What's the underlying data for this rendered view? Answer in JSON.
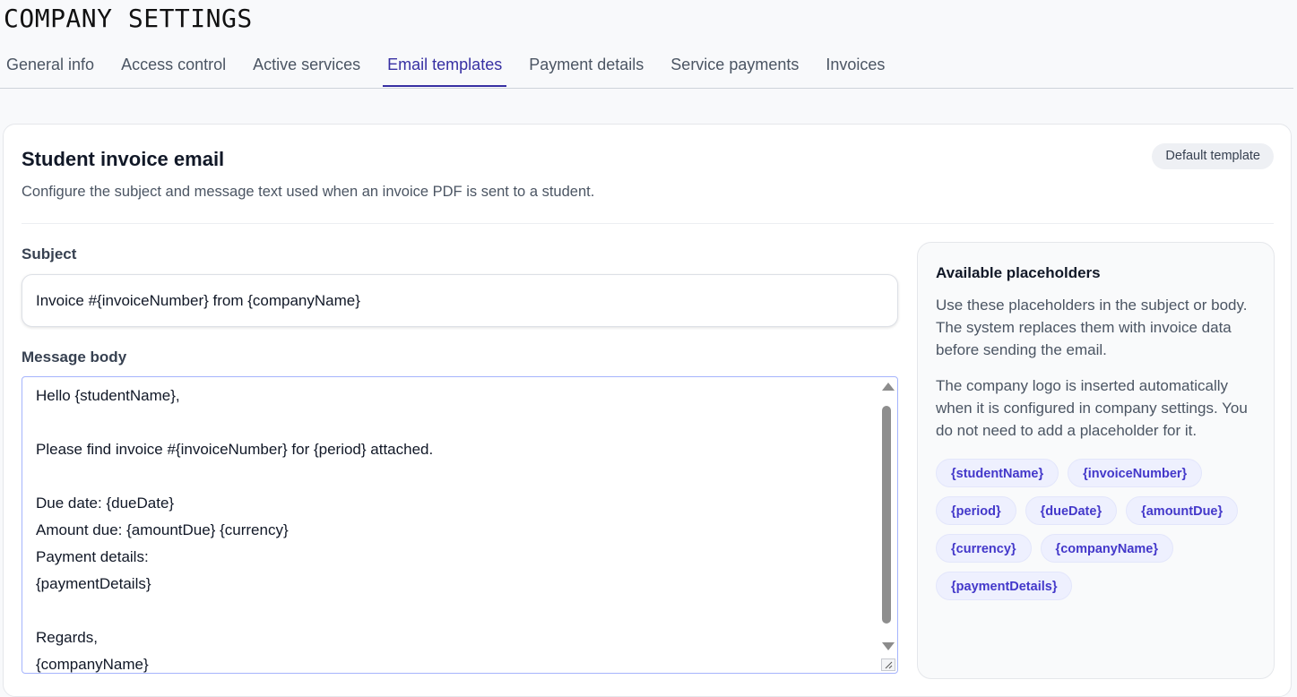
{
  "page": {
    "title": "COMPANY SETTINGS"
  },
  "tabs": [
    {
      "label": "General info",
      "active": false
    },
    {
      "label": "Access control",
      "active": false
    },
    {
      "label": "Active services",
      "active": false
    },
    {
      "label": "Email templates",
      "active": true
    },
    {
      "label": "Payment details",
      "active": false
    },
    {
      "label": "Service payments",
      "active": false
    },
    {
      "label": "Invoices",
      "active": false
    }
  ],
  "card": {
    "title": "Student invoice email",
    "description": "Configure the subject and message text used when an invoice PDF is sent to a student.",
    "badge": "Default template"
  },
  "form": {
    "subject_label": "Subject",
    "subject_value": "Invoice #{invoiceNumber} from {companyName}",
    "body_label": "Message body",
    "body_value": "Hello {studentName},\n\nPlease find invoice #{invoiceNumber} for {period} attached.\n\nDue date: {dueDate}\nAmount due: {amountDue} {currency}\nPayment details:\n{paymentDetails}\n\nRegards,\n{companyName}"
  },
  "placeholders_panel": {
    "title": "Available placeholders",
    "text1": "Use these placeholders in the subject or body. The system replaces them with invoice data before sending the email.",
    "text2": "The company logo is inserted automatically when it is configured in company settings. You do not need to add a placeholder for it.",
    "chips": [
      "{studentName}",
      "{invoiceNumber}",
      "{period}",
      "{dueDate}",
      "{amountDue}",
      "{currency}",
      "{companyName}",
      "{paymentDetails}"
    ]
  },
  "colors": {
    "accent": "#3730a3",
    "chip_text": "#4338ca",
    "chip_bg": "#eef0fe"
  },
  "icons": {
    "resize": "resize-handle-icon",
    "scroll_up": "scroll-up-arrow-icon",
    "scroll_down": "scroll-down-arrow-icon"
  }
}
